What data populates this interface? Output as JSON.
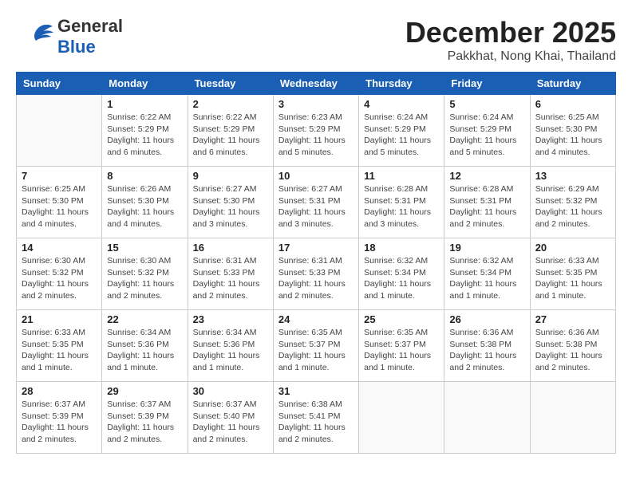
{
  "header": {
    "logo_general": "General",
    "logo_blue": "Blue",
    "month_title": "December 2025",
    "subtitle": "Pakkhat, Nong Khai, Thailand"
  },
  "weekdays": [
    "Sunday",
    "Monday",
    "Tuesday",
    "Wednesday",
    "Thursday",
    "Friday",
    "Saturday"
  ],
  "weeks": [
    [
      {
        "day": "",
        "info": ""
      },
      {
        "day": "1",
        "info": "Sunrise: 6:22 AM\nSunset: 5:29 PM\nDaylight: 11 hours\nand 6 minutes."
      },
      {
        "day": "2",
        "info": "Sunrise: 6:22 AM\nSunset: 5:29 PM\nDaylight: 11 hours\nand 6 minutes."
      },
      {
        "day": "3",
        "info": "Sunrise: 6:23 AM\nSunset: 5:29 PM\nDaylight: 11 hours\nand 5 minutes."
      },
      {
        "day": "4",
        "info": "Sunrise: 6:24 AM\nSunset: 5:29 PM\nDaylight: 11 hours\nand 5 minutes."
      },
      {
        "day": "5",
        "info": "Sunrise: 6:24 AM\nSunset: 5:29 PM\nDaylight: 11 hours\nand 5 minutes."
      },
      {
        "day": "6",
        "info": "Sunrise: 6:25 AM\nSunset: 5:30 PM\nDaylight: 11 hours\nand 4 minutes."
      }
    ],
    [
      {
        "day": "7",
        "info": "Sunrise: 6:25 AM\nSunset: 5:30 PM\nDaylight: 11 hours\nand 4 minutes."
      },
      {
        "day": "8",
        "info": "Sunrise: 6:26 AM\nSunset: 5:30 PM\nDaylight: 11 hours\nand 4 minutes."
      },
      {
        "day": "9",
        "info": "Sunrise: 6:27 AM\nSunset: 5:30 PM\nDaylight: 11 hours\nand 3 minutes."
      },
      {
        "day": "10",
        "info": "Sunrise: 6:27 AM\nSunset: 5:31 PM\nDaylight: 11 hours\nand 3 minutes."
      },
      {
        "day": "11",
        "info": "Sunrise: 6:28 AM\nSunset: 5:31 PM\nDaylight: 11 hours\nand 3 minutes."
      },
      {
        "day": "12",
        "info": "Sunrise: 6:28 AM\nSunset: 5:31 PM\nDaylight: 11 hours\nand 2 minutes."
      },
      {
        "day": "13",
        "info": "Sunrise: 6:29 AM\nSunset: 5:32 PM\nDaylight: 11 hours\nand 2 minutes."
      }
    ],
    [
      {
        "day": "14",
        "info": "Sunrise: 6:30 AM\nSunset: 5:32 PM\nDaylight: 11 hours\nand 2 minutes."
      },
      {
        "day": "15",
        "info": "Sunrise: 6:30 AM\nSunset: 5:32 PM\nDaylight: 11 hours\nand 2 minutes."
      },
      {
        "day": "16",
        "info": "Sunrise: 6:31 AM\nSunset: 5:33 PM\nDaylight: 11 hours\nand 2 minutes."
      },
      {
        "day": "17",
        "info": "Sunrise: 6:31 AM\nSunset: 5:33 PM\nDaylight: 11 hours\nand 2 minutes."
      },
      {
        "day": "18",
        "info": "Sunrise: 6:32 AM\nSunset: 5:34 PM\nDaylight: 11 hours\nand 1 minute."
      },
      {
        "day": "19",
        "info": "Sunrise: 6:32 AM\nSunset: 5:34 PM\nDaylight: 11 hours\nand 1 minute."
      },
      {
        "day": "20",
        "info": "Sunrise: 6:33 AM\nSunset: 5:35 PM\nDaylight: 11 hours\nand 1 minute."
      }
    ],
    [
      {
        "day": "21",
        "info": "Sunrise: 6:33 AM\nSunset: 5:35 PM\nDaylight: 11 hours\nand 1 minute."
      },
      {
        "day": "22",
        "info": "Sunrise: 6:34 AM\nSunset: 5:36 PM\nDaylight: 11 hours\nand 1 minute."
      },
      {
        "day": "23",
        "info": "Sunrise: 6:34 AM\nSunset: 5:36 PM\nDaylight: 11 hours\nand 1 minute."
      },
      {
        "day": "24",
        "info": "Sunrise: 6:35 AM\nSunset: 5:37 PM\nDaylight: 11 hours\nand 1 minute."
      },
      {
        "day": "25",
        "info": "Sunrise: 6:35 AM\nSunset: 5:37 PM\nDaylight: 11 hours\nand 1 minute."
      },
      {
        "day": "26",
        "info": "Sunrise: 6:36 AM\nSunset: 5:38 PM\nDaylight: 11 hours\nand 2 minutes."
      },
      {
        "day": "27",
        "info": "Sunrise: 6:36 AM\nSunset: 5:38 PM\nDaylight: 11 hours\nand 2 minutes."
      }
    ],
    [
      {
        "day": "28",
        "info": "Sunrise: 6:37 AM\nSunset: 5:39 PM\nDaylight: 11 hours\nand 2 minutes."
      },
      {
        "day": "29",
        "info": "Sunrise: 6:37 AM\nSunset: 5:39 PM\nDaylight: 11 hours\nand 2 minutes."
      },
      {
        "day": "30",
        "info": "Sunrise: 6:37 AM\nSunset: 5:40 PM\nDaylight: 11 hours\nand 2 minutes."
      },
      {
        "day": "31",
        "info": "Sunrise: 6:38 AM\nSunset: 5:41 PM\nDaylight: 11 hours\nand 2 minutes."
      },
      {
        "day": "",
        "info": ""
      },
      {
        "day": "",
        "info": ""
      },
      {
        "day": "",
        "info": ""
      }
    ]
  ]
}
